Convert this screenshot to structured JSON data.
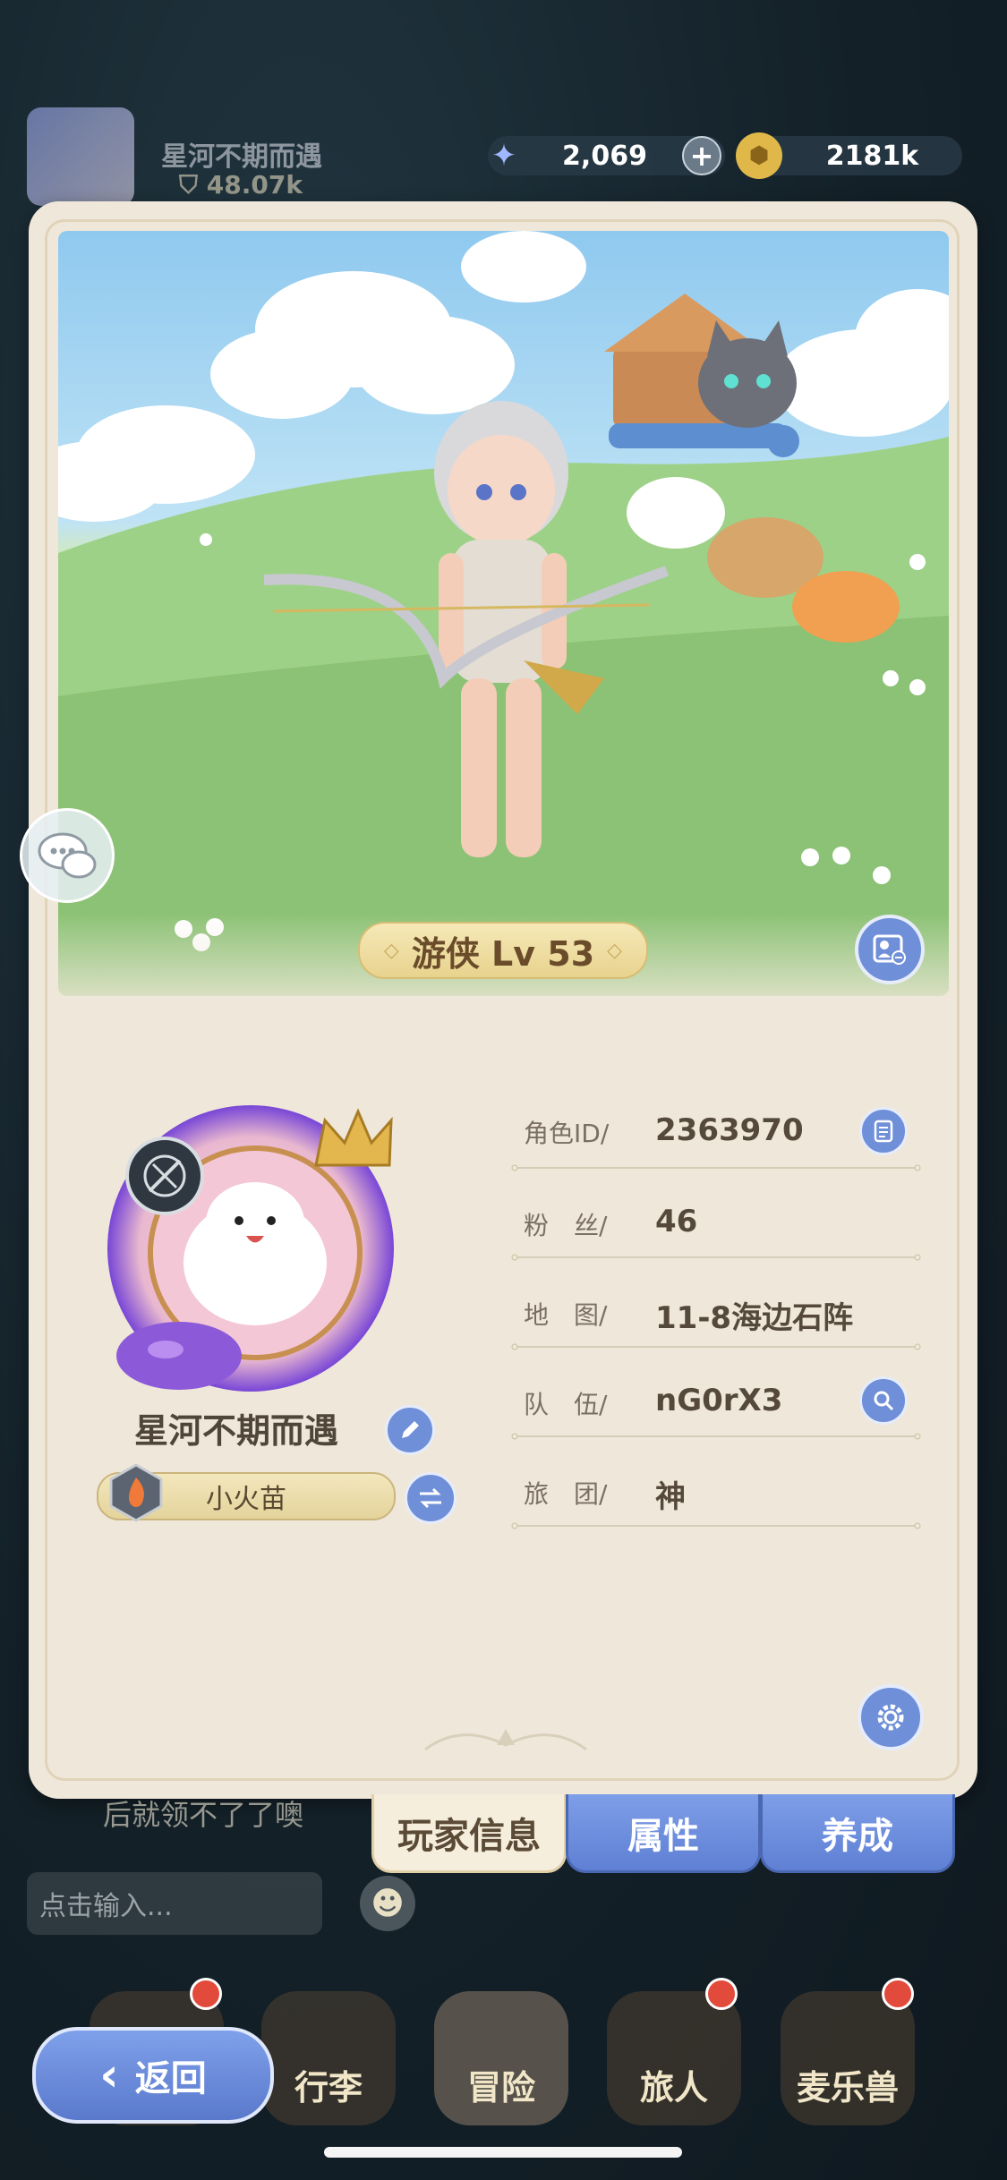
{
  "background_player": {
    "name": "星河不期而遇",
    "power": "48.07k"
  },
  "resources": {
    "gems": "2,069",
    "coins": "2181k",
    "plus_label": "+"
  },
  "character": {
    "class_label": "游侠 Lv 53"
  },
  "profile": {
    "name": "星河不期而遇",
    "title": "小火苗"
  },
  "info_rows": [
    {
      "label": "角色ID/",
      "value": "2363970"
    },
    {
      "label": "粉　丝/",
      "value": "46"
    },
    {
      "label": "地　图/",
      "value": "11-8海边石阵"
    },
    {
      "label": "队　伍/",
      "value": "nG0rX3"
    },
    {
      "label": "旅　团/",
      "value": "神"
    }
  ],
  "tabs": [
    {
      "label": "玩家信息",
      "active": true
    },
    {
      "label": "属性",
      "active": false
    },
    {
      "label": "养成",
      "active": false
    }
  ],
  "chat": {
    "last_message": "后就领不了了噢",
    "input_placeholder": "点击输入..."
  },
  "nav": [
    {
      "label": "行李"
    },
    {
      "label": "冒险"
    },
    {
      "label": "旅人"
    },
    {
      "label": "麦乐兽"
    }
  ],
  "back_label": "返回",
  "colors": {
    "card_bg": "#efe8da",
    "button_blue": "#6f8fd8",
    "text_brown": "#55493b",
    "badge_red": "#e24a3b"
  },
  "icons": [
    "star-gem-icon",
    "gold-coin-icon",
    "plus-icon",
    "chat-icon",
    "photo-card-icon",
    "edit-icon",
    "swap-icon",
    "copy-icon",
    "search-icon",
    "gear-icon",
    "crossbow-icon",
    "flame-badge-icon",
    "back-chevron-icon",
    "emoji-icon"
  ]
}
